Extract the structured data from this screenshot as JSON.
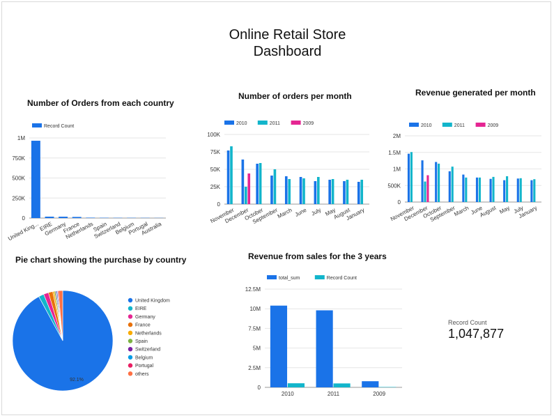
{
  "dashboard": {
    "title_line1": "Online Retail Store",
    "title_line2": "Dashboard"
  },
  "colors": {
    "blue": "#1a73e8",
    "teal": "#12b5cb",
    "pink": "#e52592",
    "orange": "#e8710a",
    "yellow": "#f9ab00",
    "green": "#7cb342",
    "purple": "#7b1fa2",
    "lightblue": "#039be5",
    "rose": "#e91e63",
    "coral": "#ff7043",
    "grid": "#e6e6e6",
    "axis": "#999999"
  },
  "scorecard": {
    "label": "Record Count",
    "value": "1,047,877"
  },
  "chart_data": [
    {
      "id": "orders_country",
      "type": "bar",
      "title": "Number of Orders from each country",
      "legend": "top-left",
      "categories": [
        "United King...",
        "EIRE",
        "Germany",
        "France",
        "Netherlands",
        "Spain",
        "Switzerland",
        "Belgium",
        "Portugal",
        "Australia"
      ],
      "series": [
        {
          "name": "Record Count",
          "color": "#1a73e8",
          "values": [
            965000,
            17500,
            17000,
            14000,
            5100,
            3700,
            3200,
            3100,
            2600,
            1900
          ]
        }
      ],
      "yticks": [
        "0",
        "250K",
        "500K",
        "750K",
        "1M"
      ],
      "ylim": [
        0,
        1000000
      ],
      "grid": true
    },
    {
      "id": "orders_month",
      "type": "bar",
      "title": "Number of orders per month",
      "legend": "top-left",
      "categories": [
        "November",
        "December",
        "October",
        "September",
        "March",
        "June",
        "July",
        "May",
        "August",
        "January"
      ],
      "series": [
        {
          "name": "2010",
          "color": "#1a73e8",
          "values": [
            77000,
            64000,
            58000,
            41000,
            40000,
            39000,
            33000,
            35000,
            33000,
            32000
          ]
        },
        {
          "name": "2011",
          "color": "#12b5cb",
          "values": [
            83000,
            25000,
            59000,
            50000,
            36000,
            37000,
            39000,
            36000,
            35000,
            35000
          ]
        },
        {
          "name": "2009",
          "color": "#e52592",
          "values": [
            null,
            44000,
            null,
            null,
            null,
            null,
            null,
            null,
            null,
            null
          ]
        }
      ],
      "yticks": [
        "0",
        "25K",
        "50K",
        "75K",
        "100K"
      ],
      "ylim": [
        0,
        100000
      ],
      "grid": true
    },
    {
      "id": "revenue_month",
      "type": "bar",
      "title": "Revenue generated per month",
      "legend": "top-left",
      "categories": [
        "November",
        "December",
        "October",
        "September",
        "March",
        "June",
        "August",
        "May",
        "July",
        "January"
      ],
      "series": [
        {
          "name": "2010",
          "color": "#1a73e8",
          "values": [
            1460000,
            1260000,
            1210000,
            930000,
            830000,
            740000,
            700000,
            660000,
            710000,
            660000
          ]
        },
        {
          "name": "2011",
          "color": "#12b5cb",
          "values": [
            1510000,
            620000,
            1160000,
            1070000,
            740000,
            740000,
            760000,
            780000,
            720000,
            690000
          ]
        },
        {
          "name": "2009",
          "color": "#e52592",
          "values": [
            null,
            810000,
            null,
            null,
            null,
            null,
            null,
            null,
            null,
            null
          ]
        }
      ],
      "yticks": [
        "0",
        "500K",
        "1M",
        "1.5M",
        "2M"
      ],
      "ylim": [
        0,
        2000000
      ],
      "grid": true
    },
    {
      "id": "pie_country",
      "type": "pie",
      "title": "Pie chart showing the purchase by country",
      "legend": "right",
      "slices": [
        {
          "label": "United Kingdom",
          "value": 92.1,
          "color": "#1a73e8"
        },
        {
          "label": "EIRE",
          "value": 1.7,
          "color": "#12b5cb"
        },
        {
          "label": "Germany",
          "value": 1.6,
          "color": "#e52592"
        },
        {
          "label": "France",
          "value": 1.4,
          "color": "#e8710a"
        },
        {
          "label": "Netherlands",
          "value": 0.5,
          "color": "#f9ab00"
        },
        {
          "label": "Spain",
          "value": 0.4,
          "color": "#7cb342"
        },
        {
          "label": "Switzerland",
          "value": 0.3,
          "color": "#7b1fa2"
        },
        {
          "label": "Belgium",
          "value": 0.3,
          "color": "#039be5"
        },
        {
          "label": "Portugal",
          "value": 0.3,
          "color": "#e91e63"
        },
        {
          "label": "others",
          "value": 1.4,
          "color": "#ff7043"
        }
      ],
      "slice_label": "92.1%"
    },
    {
      "id": "revenue_years",
      "type": "bar",
      "title": "Revenue from sales for the 3 years",
      "legend": "top-left",
      "categories": [
        "2010",
        "2011",
        "2009"
      ],
      "series": [
        {
          "name": "total_sum",
          "color": "#1a73e8",
          "values": [
            10400000,
            9800000,
            780000
          ]
        },
        {
          "name": "Record Count",
          "color": "#12b5cb",
          "values": [
            520000,
            500000,
            45000
          ]
        }
      ],
      "yticks": [
        "0",
        "2.5M",
        "5M",
        "7.5M",
        "10M",
        "12.5M"
      ],
      "ylim": [
        0,
        12500000
      ],
      "grid": true
    }
  ]
}
